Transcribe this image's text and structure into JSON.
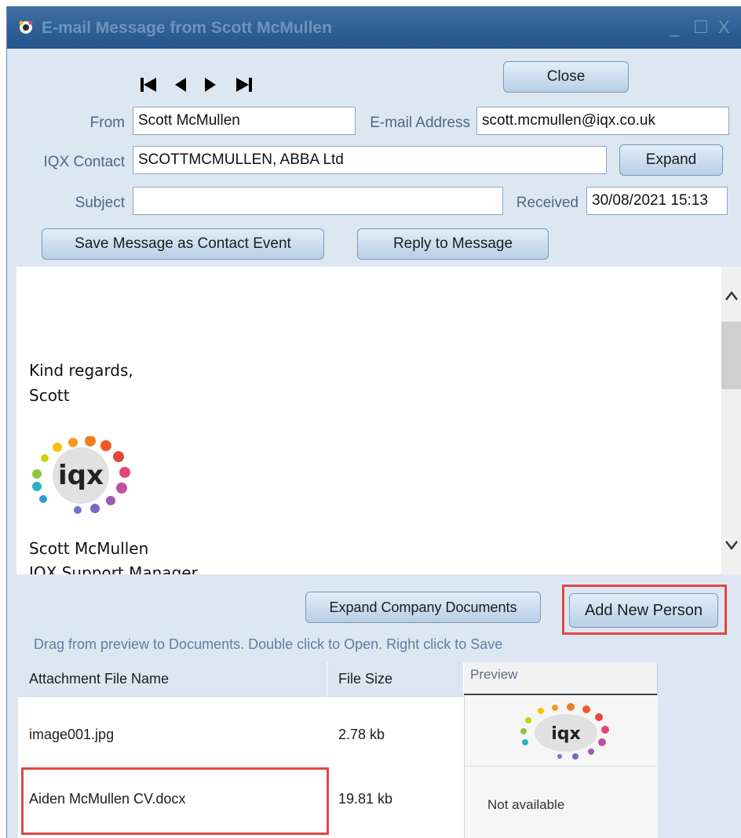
{
  "window": {
    "title": "E-mail Message from Scott McMullen",
    "minimize": "_",
    "maximize": "☐",
    "close": "X"
  },
  "nav": {
    "first_icon": "skip-first-icon",
    "prev_icon": "prev-icon",
    "next_icon": "next-icon",
    "last_icon": "skip-last-icon"
  },
  "buttons": {
    "close": "Close",
    "expand": "Expand",
    "save_event": "Save Message as Contact Event",
    "reply": "Reply to Message",
    "expand_docs": "Expand Company Documents",
    "add_person": "Add New Person"
  },
  "fields": {
    "from_label": "From",
    "from_value": "Scott McMullen",
    "email_label": "E-mail Address",
    "email_value": "scott.mcmullen@iqx.co.uk",
    "contact_label": "IQX Contact",
    "contact_value": "SCOTTMCMULLEN, ABBA Ltd",
    "subject_label": "Subject",
    "subject_value": "",
    "received_label": "Received",
    "received_value": "30/08/2021 15:13"
  },
  "message": {
    "regards": "Kind regards,",
    "name": "Scott",
    "logo_text": "iqx",
    "sig_name": "Scott McMullen",
    "sig_title": "IQX Support Manager"
  },
  "hint": "Drag from preview to Documents.  Double click to Open.  Right click to Save",
  "attachments": {
    "headers": {
      "name": "Attachment File Name",
      "size": "File Size",
      "preview": "Preview"
    },
    "rows": [
      {
        "name": "image001.jpg",
        "size": "2.78 kb",
        "preview": "iqx"
      },
      {
        "name": "Aiden McMullen CV.docx",
        "size": "19.81 kb",
        "preview": "Not available"
      }
    ]
  },
  "colors": {
    "highlight": "#e04646",
    "title_bar": "#22538a",
    "panel": "#dde7f2"
  }
}
